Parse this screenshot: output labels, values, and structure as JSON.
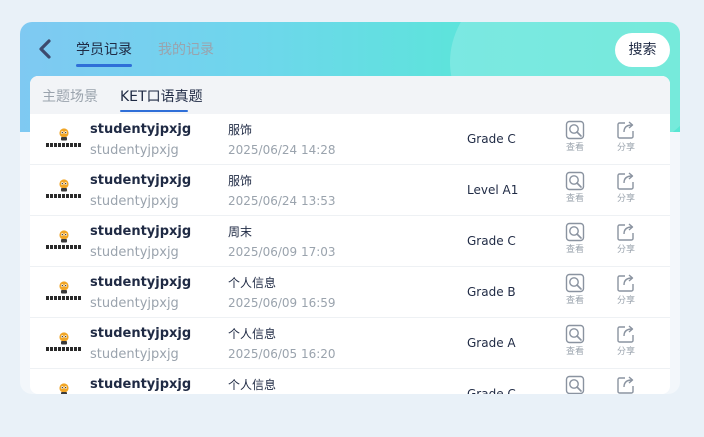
{
  "header": {
    "tabs": [
      {
        "label": "学员记录",
        "active": true
      },
      {
        "label": "我的记录",
        "active": false
      }
    ],
    "search_label": "搜索"
  },
  "subtabs": [
    {
      "label": "主题场景",
      "active": false
    },
    {
      "label": "KET口语真题",
      "active": true
    }
  ],
  "actions": {
    "view_label": "查看",
    "share_label": "分享"
  },
  "colors": {
    "accent": "#2f6fd8",
    "header_start": "#7fc9f2",
    "header_end": "#58e6d3"
  },
  "records": [
    {
      "name": "studentyjpxjg",
      "username": "studentyjpxjg",
      "topic": "服饰",
      "date": "2025/06/24 14:28",
      "grade": "Grade C"
    },
    {
      "name": "studentyjpxjg",
      "username": "studentyjpxjg",
      "topic": "服饰",
      "date": "2025/06/24 13:53",
      "grade": "Level A1"
    },
    {
      "name": "studentyjpxjg",
      "username": "studentyjpxjg",
      "topic": "周末",
      "date": "2025/06/09 17:03",
      "grade": "Grade C"
    },
    {
      "name": "studentyjpxjg",
      "username": "studentyjpxjg",
      "topic": "个人信息",
      "date": "2025/06/09 16:59",
      "grade": "Grade B"
    },
    {
      "name": "studentyjpxjg",
      "username": "studentyjpxjg",
      "topic": "个人信息",
      "date": "2025/06/05 16:20",
      "grade": "Grade A"
    },
    {
      "name": "studentyjpxjg",
      "username": "",
      "topic": "个人信息",
      "date": "",
      "grade": "Grade C"
    }
  ]
}
